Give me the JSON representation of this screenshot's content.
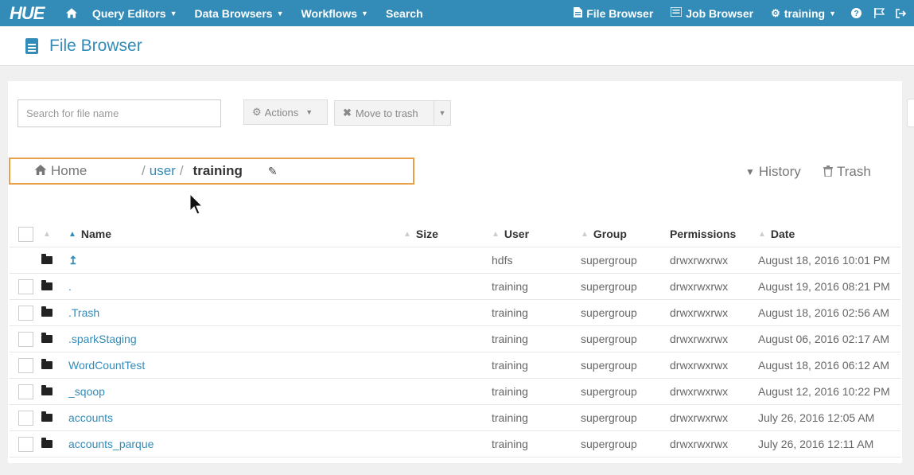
{
  "nav": {
    "logo": "HUE",
    "items": [
      {
        "label": "Query Editors"
      },
      {
        "label": "Data Browsers"
      },
      {
        "label": "Workflows"
      },
      {
        "label": "Search"
      }
    ],
    "right": {
      "file_browser": "File Browser",
      "job_browser": "Job Browser",
      "user": "training"
    }
  },
  "page": {
    "title": "File Browser"
  },
  "toolbar": {
    "search_placeholder": "Search for file name",
    "actions_label": "Actions",
    "move_to_trash_label": "Move to trash"
  },
  "breadcrumb": {
    "home": "Home",
    "sep": "/",
    "user": "user",
    "current": "training"
  },
  "links": {
    "history": "History",
    "trash": "Trash"
  },
  "table": {
    "columns": {
      "name": "Name",
      "size": "Size",
      "user": "User",
      "group": "Group",
      "permissions": "Permissions",
      "date": "Date"
    },
    "rows": [
      {
        "name": "↥",
        "size": "",
        "user": "hdfs",
        "group": "supergroup",
        "permissions": "drwxrwxrwx",
        "date": "August 18, 2016 10:01 PM"
      },
      {
        "name": ".",
        "size": "",
        "user": "training",
        "group": "supergroup",
        "permissions": "drwxrwxrwx",
        "date": "August 19, 2016 08:21 PM"
      },
      {
        "name": ".Trash",
        "size": "",
        "user": "training",
        "group": "supergroup",
        "permissions": "drwxrwxrwx",
        "date": "August 18, 2016 02:56 AM"
      },
      {
        "name": ".sparkStaging",
        "size": "",
        "user": "training",
        "group": "supergroup",
        "permissions": "drwxrwxrwx",
        "date": "August 06, 2016 02:17 AM"
      },
      {
        "name": "WordCountTest",
        "size": "",
        "user": "training",
        "group": "supergroup",
        "permissions": "drwxrwxrwx",
        "date": "August 18, 2016 06:12 AM"
      },
      {
        "name": "_sqoop",
        "size": "",
        "user": "training",
        "group": "supergroup",
        "permissions": "drwxrwxrwx",
        "date": "August 12, 2016 10:22 PM"
      },
      {
        "name": "accounts",
        "size": "",
        "user": "training",
        "group": "supergroup",
        "permissions": "drwxrwxrwx",
        "date": "July 26, 2016 12:05 AM"
      },
      {
        "name": "accounts_parque",
        "size": "",
        "user": "training",
        "group": "supergroup",
        "permissions": "drwxrwxrwx",
        "date": "July 26, 2016 12:11 AM"
      }
    ]
  }
}
